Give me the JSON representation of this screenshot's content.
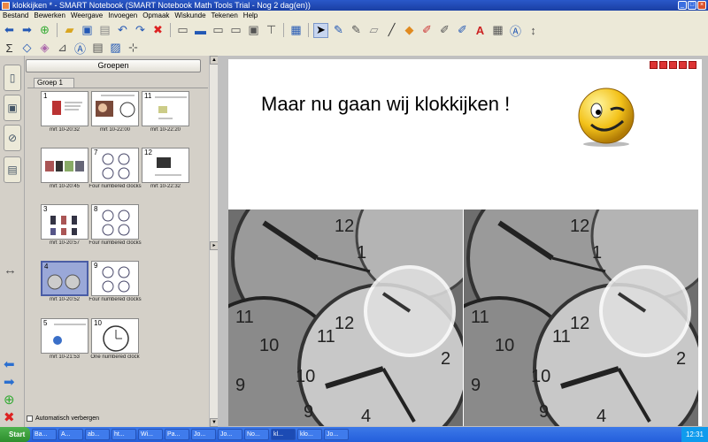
{
  "window": {
    "title": "klokkijken * - SMART Notebook (SMART Notebook Math Tools Trial - Nog 2 dag(en))"
  },
  "menu": [
    "Bestand",
    "Bewerken",
    "Weergave",
    "Invoegen",
    "Opmaak",
    "Wiskunde",
    "Tekenen",
    "Help"
  ],
  "sorter": {
    "group_button": "Groepen",
    "group_tab": "Groep 1",
    "autohide_label": "Automatisch verbergen",
    "pages": [
      {
        "num": "1",
        "caption": "mrt 10-20:32"
      },
      {
        "num": "",
        "caption": "mrt 10-22:00"
      },
      {
        "num": "11",
        "caption": "mrt 10-22:20"
      },
      {
        "num": "",
        "caption": "mrt 10-20:45"
      },
      {
        "num": "7",
        "caption": "Four numbered clocks"
      },
      {
        "num": "12",
        "caption": "mrt 10-22:32"
      },
      {
        "num": "3",
        "caption": "mrt 10-20:57"
      },
      {
        "num": "8",
        "caption": "Four numbered clocks"
      },
      {
        "num": "4",
        "caption": "mrt 10-20:52"
      },
      {
        "num": "9",
        "caption": "Four numbered clocks"
      },
      {
        "num": "5",
        "caption": "mrt 10-21:53"
      },
      {
        "num": "10",
        "caption": "One numbered clock"
      }
    ]
  },
  "canvas": {
    "heading": "Maar nu gaan wij klokkijken !"
  },
  "taskbar": {
    "start": "Start",
    "items": [
      "Ba...",
      "A...",
      "ab...",
      "ht...",
      "Wi...",
      "Pa...",
      "Jo...",
      "Jo...",
      "No...",
      "kl...",
      "klo...",
      "Jo..."
    ],
    "clock": "12:31"
  }
}
